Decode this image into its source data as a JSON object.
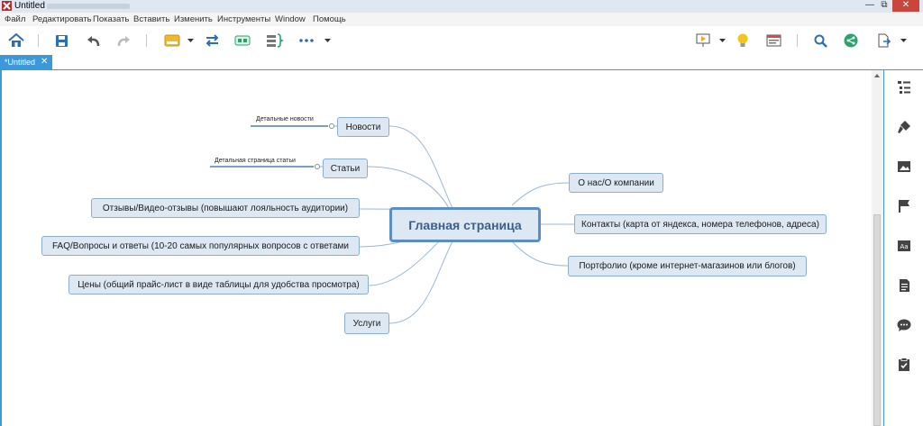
{
  "window": {
    "title": "Untitled",
    "controls": [
      "—",
      "⧉",
      "✕"
    ]
  },
  "menu": [
    "Файл",
    "Редактировать",
    "Показать",
    "Вставить",
    "Изменить",
    "Инструменты",
    "Window",
    "Помощь"
  ],
  "toolbar": {
    "left_icons": [
      "home-icon",
      "save-icon",
      "undo-icon",
      "redo-icon",
      "topic-style-icon",
      "relationship-icon",
      "boundary-icon",
      "summary-icon",
      "more-icon"
    ],
    "right_icons": [
      "presentation-icon",
      "brainstorm-icon",
      "outline-view-icon",
      "search-icon",
      "share-icon",
      "export-icon"
    ]
  },
  "tab": {
    "label": "*Untitled",
    "close": "✕"
  },
  "mindmap": {
    "central": "Главная страница",
    "left_topics": [
      "Новости",
      "Статьи",
      "Отзывы/Видео-отзывы (повышают лояльность аудитории)",
      "FAQ/Вопросы и ответы (10-20 самых популярных вопросов с ответами",
      "Цены (общий прайс-лист в виде таблицы для удобства просмотра)",
      "Услуги"
    ],
    "right_topics": [
      "О нас/О компании",
      "Контакты (карта от яндекса, номера телефонов, адреса)",
      "Портфолио (кроме интернет-магазинов или блогов)"
    ],
    "subtopics": [
      "Детальные новости",
      "Детальная страница статьи"
    ]
  },
  "right_panel_icons": [
    "outliner-icon",
    "format-brush-icon",
    "image-icon",
    "marker-flag-icon",
    "text-style-icon",
    "notes-icon",
    "comment-icon",
    "task-icon"
  ],
  "colors": {
    "accent": "#3c98d8",
    "topic_fill": "#dde8f3",
    "topic_border": "#8aaed0",
    "central_border": "#5b8ec4"
  }
}
